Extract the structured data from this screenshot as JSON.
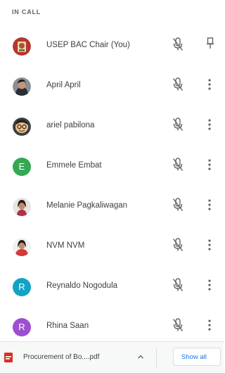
{
  "section": {
    "title": "IN CALL"
  },
  "participants": [
    {
      "name": "USEP BAC Chair (You)",
      "avatar_type": "photo",
      "action_icon": "pin-icon"
    },
    {
      "name": "April April",
      "avatar_type": "photo",
      "action_icon": "more-vert-icon"
    },
    {
      "name": "ariel pabilona",
      "avatar_type": "photo",
      "action_icon": "more-vert-icon"
    },
    {
      "name": "Emmele Embat",
      "avatar_type": "letter",
      "initial": "E",
      "color": "#34a853",
      "action_icon": "more-vert-icon"
    },
    {
      "name": "Melanie Pagkaliwagan",
      "avatar_type": "photo",
      "action_icon": "more-vert-icon"
    },
    {
      "name": "NVM NVM",
      "avatar_type": "photo",
      "action_icon": "more-vert-icon"
    },
    {
      "name": "Reynaldo Nogodula",
      "avatar_type": "letter",
      "initial": "R",
      "color": "#12a3c4",
      "action_icon": "more-vert-icon"
    },
    {
      "name": "Rhina Saan",
      "avatar_type": "letter",
      "initial": "R",
      "color": "#9c4fd0",
      "action_icon": "more-vert-icon"
    }
  ],
  "download_bar": {
    "file_name": "Procurement of Bo....pdf",
    "show_all_label": "Show all",
    "pdf_icon_color": "#d93025"
  },
  "colors": {
    "mic_off_icon": "#5f6368",
    "link": "#1a73e8"
  }
}
